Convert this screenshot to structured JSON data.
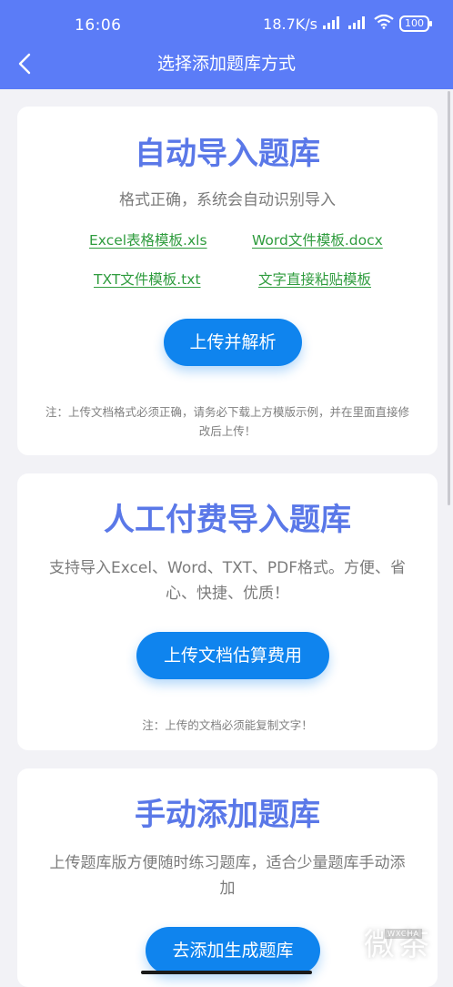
{
  "status_bar": {
    "time": "16:06",
    "network_speed": "18.7K/s",
    "battery": "100"
  },
  "header": {
    "title": "选择添加题库方式"
  },
  "auto_import": {
    "title": "自动导入题库",
    "description": "格式正确，系统会自动识别导入",
    "templates": [
      "Excel表格模板.xls",
      "Word文件模板.docx",
      "TXT文件模板.txt",
      "文字直接粘贴模板"
    ],
    "button_label": "上传并解析",
    "note": "注：上传文档格式必须正确，请务必下载上方模版示例，并在里面直接修改后上传！"
  },
  "paid_import": {
    "title": "人工付费导入题库",
    "description": "支持导入Excel、Word、TXT、PDF格式。方便、省心、快捷、优质！",
    "button_label": "上传文档估算费用",
    "note": "注：上传的文档必须能复制文字！"
  },
  "manual_add": {
    "title": "手动添加题库",
    "description": "上传题库版方便随时练习题库，适合少量题库手动添加",
    "button_label": "去添加生成题库"
  },
  "watermark": {
    "text": "微茶",
    "small_text": "WXCHA"
  },
  "colors": {
    "header_bg": "#5b7cf7",
    "title": "#5a78e8",
    "link": "#2f9c3e",
    "button": "#0f84ee"
  }
}
